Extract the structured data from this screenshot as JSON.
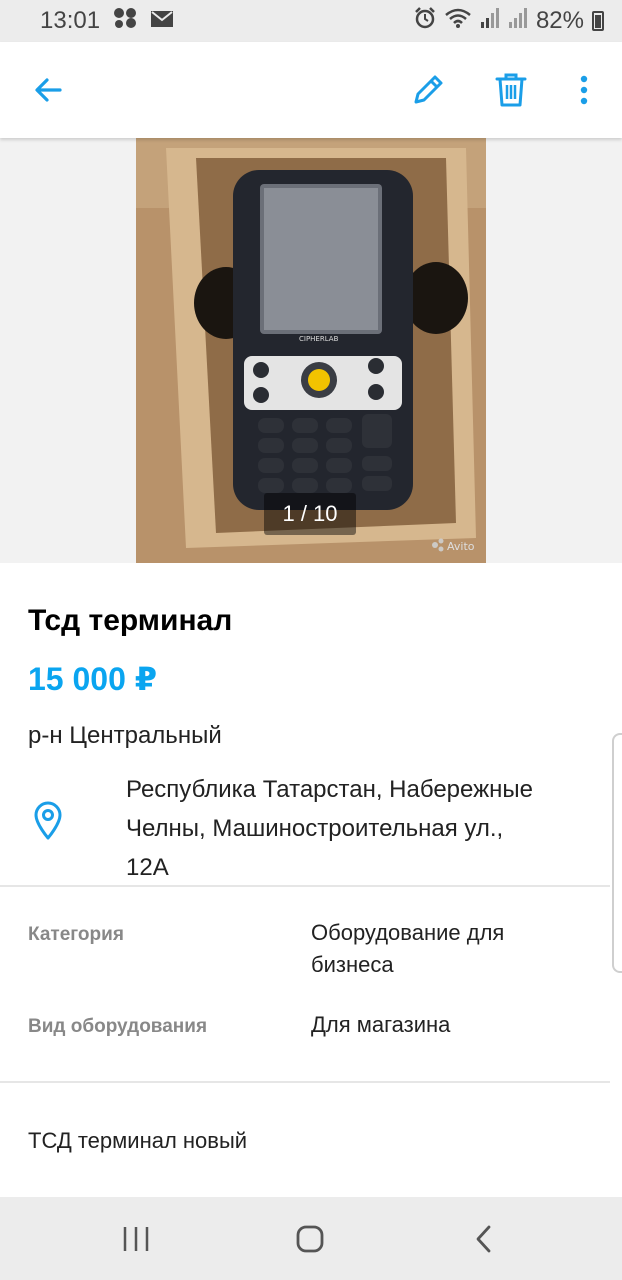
{
  "status_bar": {
    "time": "13:01",
    "battery": "82%",
    "icons": [
      "bubbles-icon",
      "mail-icon",
      "alarm-icon",
      "wifi-icon",
      "signal-icon",
      "signal-icon",
      "battery-icon"
    ]
  },
  "app_bar": {
    "icons": [
      "back-arrow-icon",
      "edit-pencil-icon",
      "trash-icon",
      "more-vertical-icon"
    ],
    "accent": "#1a9ee8"
  },
  "photo": {
    "counter": "1 / 10",
    "watermark": "Avito",
    "device_brand": "CIPHERLAB"
  },
  "listing": {
    "title": "Тсд терминал",
    "price": "15 000 ₽",
    "price_color": "#0aa5f0",
    "district": "р-н Центральный",
    "address_lines": [
      "Республика Татарстан, Набережные",
      "Челны, Машиностроительная ул.,",
      "12А"
    ],
    "address_icon": "location-pin-icon"
  },
  "params": [
    {
      "label": "Категория",
      "value_lines": [
        "Оборудование для",
        "бизнеса"
      ]
    },
    {
      "label": "Вид оборудования",
      "value_lines": [
        "Для магазина"
      ]
    }
  ],
  "description": "ТСД терминал новый",
  "nav_bar": {
    "icons": [
      "recents-icon",
      "home-icon",
      "back-icon"
    ]
  }
}
